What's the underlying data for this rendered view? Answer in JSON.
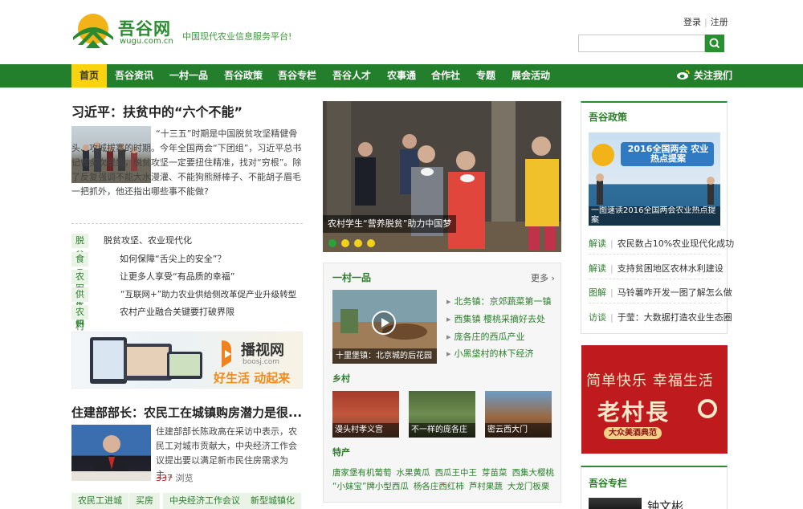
{
  "header": {
    "logo_text": "吾谷网",
    "logo_url": "wugu.com.cn",
    "slogan": "中国现代农业信息服务平台!",
    "login": "登录",
    "register": "注册",
    "search_placeholder": ""
  },
  "nav": {
    "items": [
      "首页",
      "吾谷资讯",
      "一村一品",
      "吾谷政策",
      "吾谷专栏",
      "吾谷人才",
      "农事通",
      "合作社",
      "专题",
      "展会活动"
    ],
    "follow": "关注我们"
  },
  "left": {
    "headline1": "习近平：扶贫中的“六个不能”",
    "summary1": "“十三五”时期是中国脱贫攻坚精健骨头、攻城拔寨的时期。今年全国两会“下团组”，习近平总书记曾多次提到，脱贫攻坚一定要扭住精准，找对“穷根”。除了反复强调不能大水漫灌、不能狗熊掰棒子、不能胡子眉毛一把抓外，他还指出哪些事不能做?",
    "topics": [
      {
        "tag": "脱贫",
        "text": "脱贫攻坚、农业现代化"
      },
      {
        "tag": "食品安全",
        "text": "如何保障“舌尖上的安全”？"
      },
      {
        "tag": "农村生活",
        "text": "让更多人享受“有品质的幸福”"
      },
      {
        "tag": "供给侧改革",
        "text": "“互联网+”助力农业供给侧改革促产业升级转型"
      },
      {
        "tag": "农村产业",
        "text": "农村产业融合关键要打破界限"
      }
    ],
    "ad_title": "播视网",
    "ad_url": "boosj.com",
    "ad_slogan": "好生活 动起来",
    "headline2": "住建部部长：农民工在城镇购房潜力是很...",
    "summary2": "住建部部长陈政高在采访中表示，农民工对城市贡献大，中央经济工作会议提出要以满足新市民住房需求为主...",
    "views_count": "337",
    "views_label": "浏览",
    "bottom_tags": [
      "农民工进城",
      "买房",
      "中央经济工作会议",
      "新型城镇化"
    ]
  },
  "middle": {
    "slider_caption": "农村学生“营养脱贫”助力中国梦",
    "slider_index": 1,
    "slider_total": 4,
    "panel_title": "一村一品",
    "panel_more": "更多",
    "video_caption": "十里堡镇：北京城的后花园",
    "list": [
      {
        "green": "北务镇：",
        "rest": "京郊蔬菜第一镇"
      },
      {
        "green": "西集镇",
        "rest": "樱桃采摘好去处"
      },
      {
        "green": "",
        "rest": "庞各庄的西瓜产业"
      },
      {
        "green": "",
        "rest": "小黑垡村的林下经济"
      }
    ],
    "village_title": "乡村",
    "villages": [
      "漫头村孝义宫",
      "不一样的庞各庄",
      "密云西大门"
    ],
    "specialty_title": "特产",
    "specialties_row1": [
      "唐家堡有机葡萄",
      "水果黄瓜",
      "西瓜王中王",
      "芽苗菜",
      "西集大樱桃"
    ],
    "specialties_row2": [
      "“小妹宝”牌小型西瓜",
      "杨各庄西红柿",
      "芦村果蔬",
      "大龙门板栗"
    ]
  },
  "right": {
    "policy_title": "吾谷政策",
    "pic_banner": "2016全国两会 农业热点提案",
    "pic_caption": "一图速读2016全国两会农业热点提案",
    "policy_list": [
      {
        "cat": "解读",
        "text": "农民数占10%农业现代化成功"
      },
      {
        "cat": "解读",
        "text": "支持贫困地区农林水利建设"
      },
      {
        "cat": "图解",
        "text": "马铃薯咋开发一图了解怎么做"
      },
      {
        "cat": "访谈",
        "text": "于莹：大数据打造农业生态圈"
      }
    ],
    "ad_line1": "简单快乐 幸福生活",
    "ad_brand": "老村長",
    "ad_sub": "大众美酒典范",
    "column_title": "吾谷专栏",
    "column_name": "钟文彬"
  },
  "colors": {
    "brand_green": "#237f2b",
    "nav_active": "#f9d30e",
    "tag_bg": "#e9f3e6",
    "ad_red": "#bf1b1f"
  }
}
